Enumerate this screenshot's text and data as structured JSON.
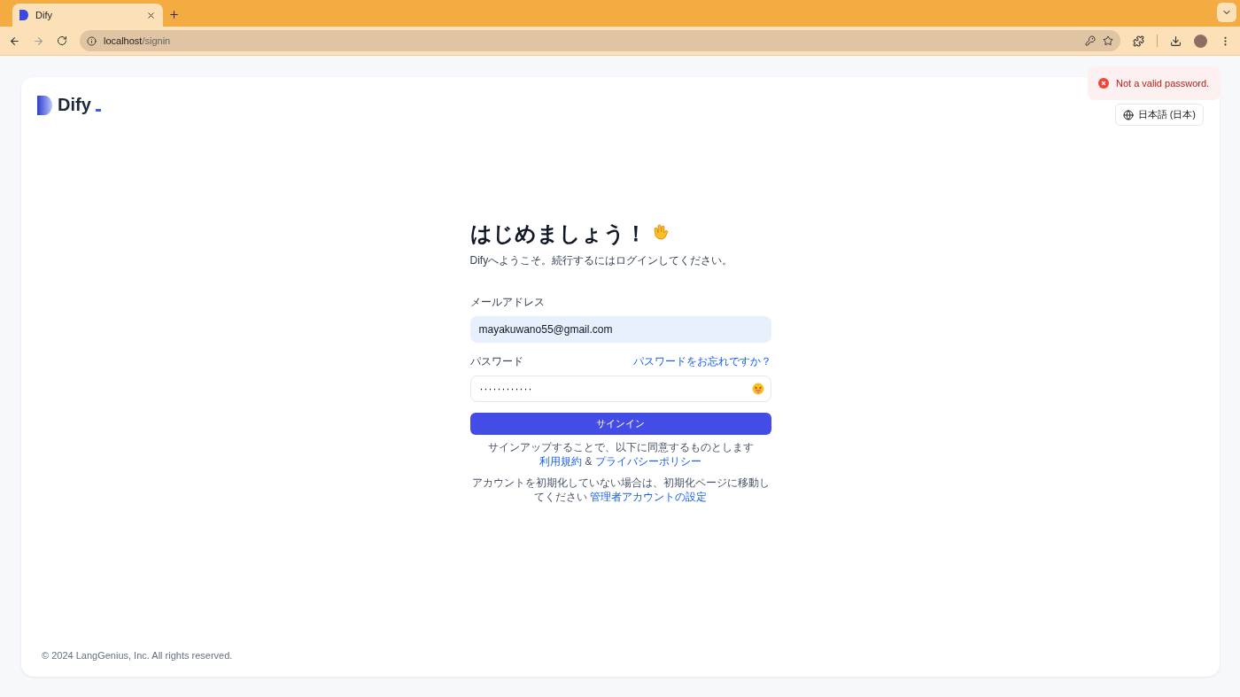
{
  "browser": {
    "tab_title": "Dify",
    "url_host": "localhost",
    "url_path": "/signin"
  },
  "header": {
    "logo_text": "Dify",
    "language": "日本語 (日本)"
  },
  "toast": {
    "kind": "error",
    "message": "Not a valid password."
  },
  "form": {
    "title": "はじめましょう！",
    "subtitle": "Difyへようこそ。続行するにはログインしてください。",
    "email_label": "メールアドレス",
    "email_value": "mayakuwano55@gmail.com",
    "password_label": "パスワード",
    "forgot_link": "パスワードをお忘れですか？",
    "password_value": "············",
    "submit": "サインイン",
    "terms_text": "サインアップすることで、以下に同意するものとします",
    "terms_link": "利用規約",
    "terms_and": "&",
    "privacy_link": "プライバシーポリシー",
    "init_text": "アカウントを初期化していない場合は、初期化ページに移動してください",
    "init_link": "管理者アカウントの設定"
  },
  "footer": {
    "copyright": "© 2024 LangGenius, Inc. All rights reserved."
  }
}
